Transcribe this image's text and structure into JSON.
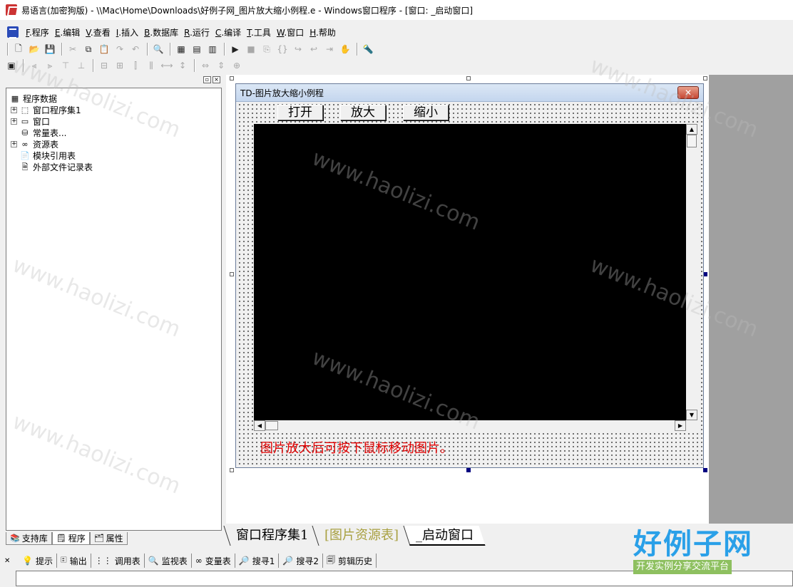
{
  "window": {
    "title": "易语言(加密狗版) - \\\\Mac\\Home\\Downloads\\好例子网_图片放大缩小例程.e - Windows窗口程序 - [窗口: _启动窗口]"
  },
  "menu": [
    {
      "key": "F",
      "label": ".程序"
    },
    {
      "key": "E",
      "label": ".编辑"
    },
    {
      "key": "V",
      "label": ".查看"
    },
    {
      "key": "I",
      "label": ".插入"
    },
    {
      "key": "B",
      "label": ".数据库"
    },
    {
      "key": "R",
      "label": ".运行"
    },
    {
      "key": "C",
      "label": ".编译"
    },
    {
      "key": "T",
      "label": ".工具"
    },
    {
      "key": "W",
      "label": ".窗口"
    },
    {
      "key": "H",
      "label": ".帮助"
    }
  ],
  "tree": {
    "root": "程序数据",
    "items": [
      {
        "label": "窗口程序集1",
        "expander": "+",
        "icon": "module-icon"
      },
      {
        "label": "窗口",
        "expander": "+",
        "icon": "window-icon"
      },
      {
        "label": "常量表...",
        "expander": "",
        "icon": "constant-icon"
      },
      {
        "label": "资源表",
        "expander": "+",
        "icon": "resource-icon"
      },
      {
        "label": "模块引用表",
        "expander": "",
        "icon": "module-ref-icon"
      },
      {
        "label": "外部文件记录表",
        "expander": "",
        "icon": "file-record-icon"
      }
    ]
  },
  "left_tabs": [
    {
      "label": "支持库",
      "icon": "library-icon"
    },
    {
      "label": "程序",
      "icon": "program-icon"
    },
    {
      "label": "属性",
      "icon": "property-icon"
    }
  ],
  "form": {
    "title": "TD-图片放大缩小例程",
    "close": "✕",
    "buttons": [
      {
        "label": "打开"
      },
      {
        "label": "放大"
      },
      {
        "label": "缩小"
      }
    ],
    "hint": "图片放大后可按下鼠标移动图片。"
  },
  "window_tabs": [
    {
      "label": "窗口程序集1"
    },
    {
      "label": "[图片资源表]"
    },
    {
      "label": "_启动窗口"
    }
  ],
  "output_tabs": [
    {
      "label": "提示",
      "icon": "hint-icon"
    },
    {
      "label": "输出",
      "icon": "output-icon"
    },
    {
      "label": "调用表",
      "icon": "call-table-icon"
    },
    {
      "label": "监视表",
      "icon": "watch-icon"
    },
    {
      "label": "变量表",
      "icon": "variable-icon"
    },
    {
      "label": "搜寻1",
      "icon": "search1-icon"
    },
    {
      "label": "搜寻2",
      "icon": "search2-icon"
    },
    {
      "label": "剪辑历史",
      "icon": "clip-history-icon"
    }
  ],
  "watermark": {
    "title": "好例子网",
    "subtitle": "开发实例分享交流平台",
    "text": "www.haolizi.com"
  },
  "colors": {
    "hint_red": "#e00000",
    "picture_bg": "#000000",
    "resource_tab": "#a8a040",
    "watermark_blue": "#2aa0e8",
    "watermark_green": "#8ec060"
  }
}
